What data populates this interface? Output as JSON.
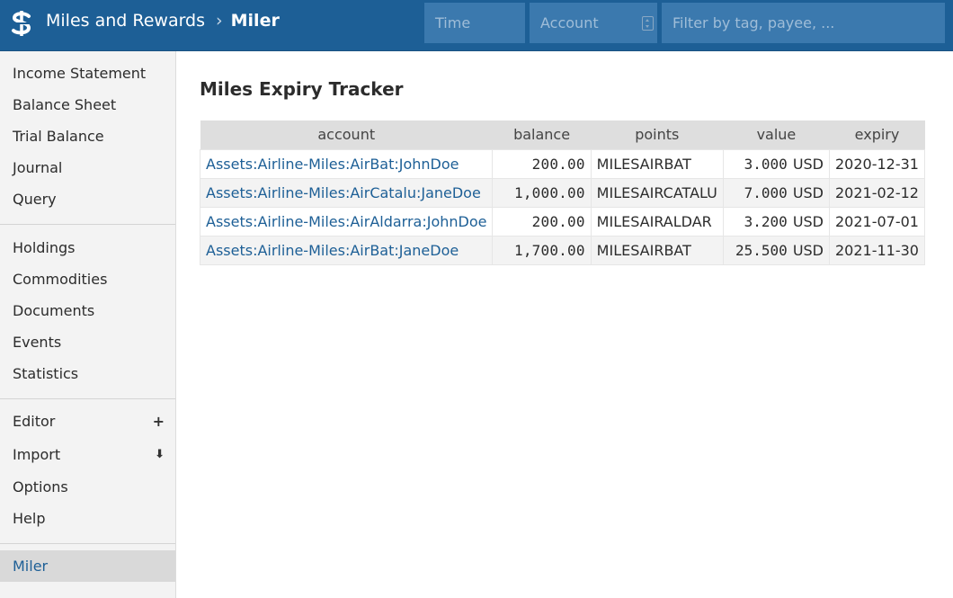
{
  "header": {
    "app_title": "Miles and Rewards",
    "separator": "›",
    "current_page": "Miler",
    "time_placeholder": "Time",
    "account_placeholder": "Account",
    "filter_placeholder": "Filter by tag, payee, ...",
    "logo_icon": "fava-dollar-logo-icon",
    "bar_color": "#1d5f96"
  },
  "sidebar": {
    "group1": [
      "Income Statement",
      "Balance Sheet",
      "Trial Balance",
      "Journal",
      "Query"
    ],
    "group2": [
      "Holdings",
      "Commodities",
      "Documents",
      "Events",
      "Statistics"
    ],
    "group3": [
      {
        "label": "Editor",
        "extra": "+",
        "icon": "plus-icon"
      },
      {
        "label": "Import",
        "extra": "⬇",
        "icon": "download-icon"
      },
      {
        "label": "Options",
        "extra": ""
      },
      {
        "label": "Help",
        "extra": ""
      }
    ],
    "extensions": [
      "Miler"
    ],
    "active": "Miler"
  },
  "main": {
    "title": "Miles Expiry Tracker",
    "columns": [
      "account",
      "balance",
      "points",
      "value",
      "expiry"
    ],
    "rows": [
      {
        "account": "Assets:Airline-Miles:AirBat:JohnDoe",
        "balance": "200.00",
        "points": "MILESAIRBAT",
        "value": "3.000",
        "currency": "USD",
        "expiry": "2020-12-31"
      },
      {
        "account": "Assets:Airline-Miles:AirCatalu:JaneDoe",
        "balance": "1,000.00",
        "points": "MILESAIRCATALU",
        "value": "7.000",
        "currency": "USD",
        "expiry": "2021-02-12"
      },
      {
        "account": "Assets:Airline-Miles:AirAldarra:JohnDoe",
        "balance": "200.00",
        "points": "MILESAIRALDAR",
        "value": "3.200",
        "currency": "USD",
        "expiry": "2021-07-01"
      },
      {
        "account": "Assets:Airline-Miles:AirBat:JaneDoe",
        "balance": "1,700.00",
        "points": "MILESAIRBAT",
        "value": "25.500",
        "currency": "USD",
        "expiry": "2021-11-30"
      }
    ]
  }
}
